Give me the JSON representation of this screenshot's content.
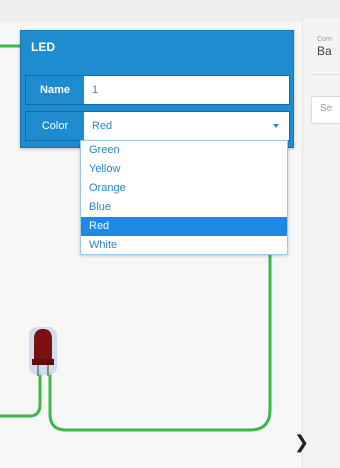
{
  "dialog": {
    "title": "LED",
    "name_label": "Name",
    "name_value": "1",
    "color_label": "Color",
    "color_value": "Red",
    "color_caret_icon": "caret-down-icon",
    "color_options": [
      "Green",
      "Yellow",
      "Orange",
      "Blue",
      "Red",
      "White"
    ],
    "selected_option": "Red"
  },
  "right_panel": {
    "label_prefix": "Com",
    "value_prefix": "Ba",
    "search_prefix": "Se",
    "collapse_icon": "chevron-right-icon",
    "collapse_glyph": "❯"
  },
  "colors": {
    "accent": "#1e8ccf",
    "selected": "#1e88e5",
    "wire": "#3cb84a",
    "led_body": "#7a1010"
  }
}
